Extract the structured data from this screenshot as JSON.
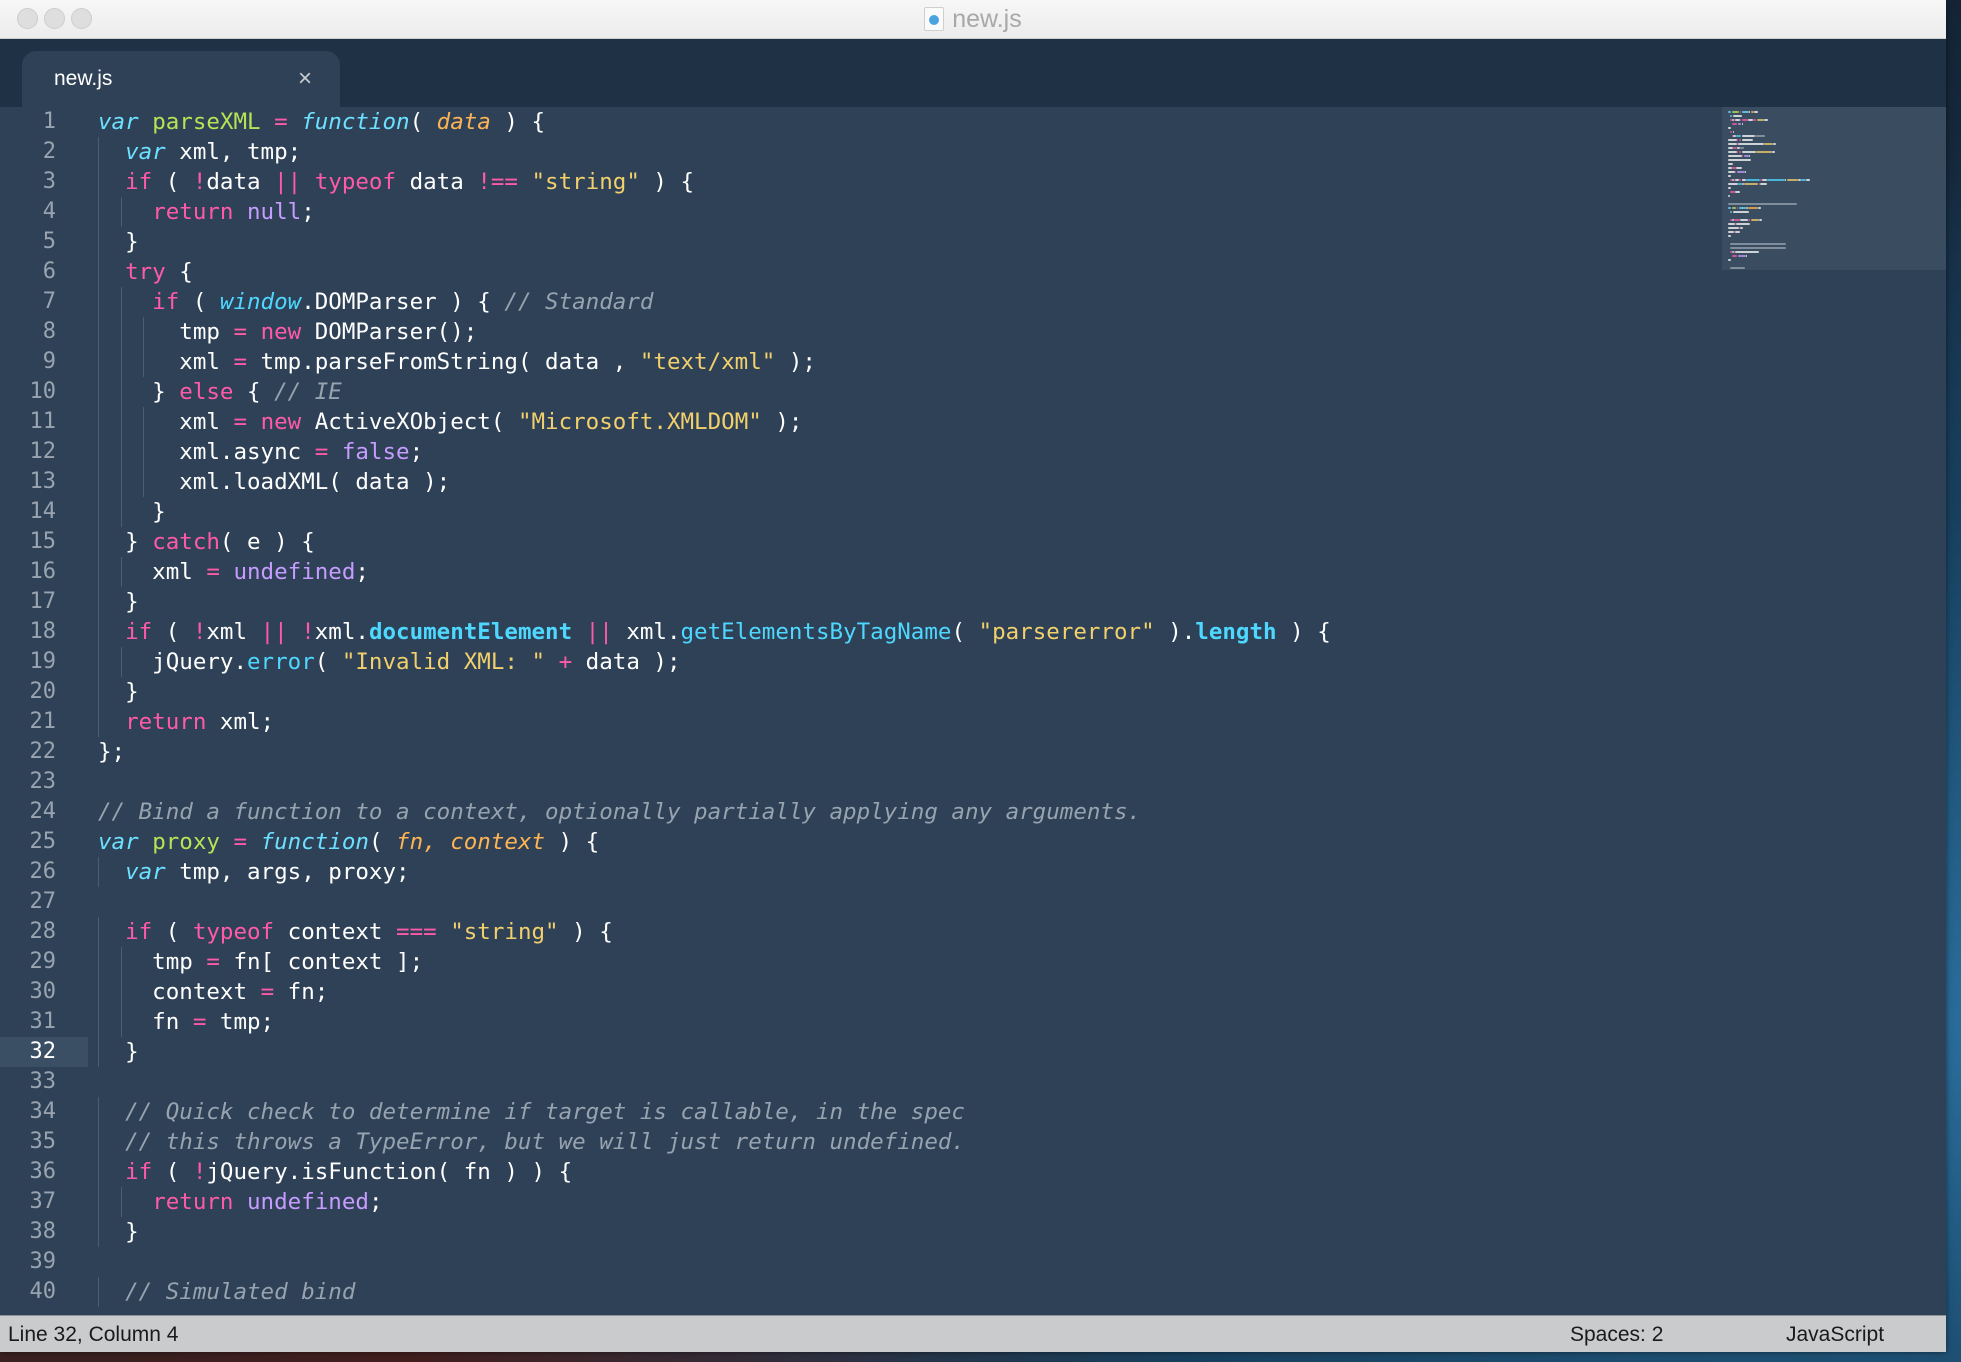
{
  "window": {
    "title": "new.js",
    "file_icon": "javascript-file-icon"
  },
  "tab": {
    "label": "new.js",
    "close_glyph": "×"
  },
  "editor": {
    "current_line": 32
  },
  "colors": {
    "background": "#2e4157",
    "plain": "#ffffff",
    "keyword": "#ff5aa8",
    "storage": "#6ee0ff",
    "function_name": "#b6e354",
    "parameter": "#ffb454",
    "string": "#f2d06b",
    "comment": "#98a3b0",
    "constant": "#c79cff",
    "support": "#4fd8ff",
    "operator": "#ff5aa8"
  },
  "code_lines": [
    [
      [
        "storage-i",
        "var"
      ],
      [
        "p",
        " "
      ],
      [
        "fn",
        "parseXML"
      ],
      [
        "p",
        " "
      ],
      [
        "op",
        "="
      ],
      [
        "p",
        " "
      ],
      [
        "storage-i",
        "function"
      ],
      [
        "p",
        "( "
      ],
      [
        "param",
        "data"
      ],
      [
        "p",
        " ) {"
      ]
    ],
    [
      [
        "p",
        "  "
      ],
      [
        "storage-i",
        "var"
      ],
      [
        "p",
        " xml, tmp;"
      ]
    ],
    [
      [
        "p",
        "  "
      ],
      [
        "kw",
        "if"
      ],
      [
        "p",
        " ( "
      ],
      [
        "op",
        "!"
      ],
      [
        "p",
        "data "
      ],
      [
        "op",
        "||"
      ],
      [
        "p",
        " "
      ],
      [
        "kw",
        "typeof"
      ],
      [
        "p",
        " data "
      ],
      [
        "op",
        "!=="
      ],
      [
        "p",
        " "
      ],
      [
        "str",
        "\"string\""
      ],
      [
        "p",
        " ) {"
      ]
    ],
    [
      [
        "p",
        "    "
      ],
      [
        "kw",
        "return"
      ],
      [
        "p",
        " "
      ],
      [
        "const",
        "null"
      ],
      [
        "p",
        ";"
      ]
    ],
    [
      [
        "p",
        "  }"
      ]
    ],
    [
      [
        "p",
        "  "
      ],
      [
        "kw",
        "try"
      ],
      [
        "p",
        " {"
      ]
    ],
    [
      [
        "p",
        "    "
      ],
      [
        "kw",
        "if"
      ],
      [
        "p",
        " ( "
      ],
      [
        "support-i",
        "window"
      ],
      [
        "p",
        ".DOMParser ) { "
      ],
      [
        "cm",
        "// Standard"
      ]
    ],
    [
      [
        "p",
        "      tmp "
      ],
      [
        "op",
        "="
      ],
      [
        "p",
        " "
      ],
      [
        "kw",
        "new"
      ],
      [
        "p",
        " DOMParser();"
      ]
    ],
    [
      [
        "p",
        "      xml "
      ],
      [
        "op",
        "="
      ],
      [
        "p",
        " tmp.parseFromString( data , "
      ],
      [
        "str",
        "\"text/xml\""
      ],
      [
        "p",
        " );"
      ]
    ],
    [
      [
        "p",
        "    } "
      ],
      [
        "kw",
        "else"
      ],
      [
        "p",
        " { "
      ],
      [
        "cm",
        "// IE"
      ]
    ],
    [
      [
        "p",
        "      xml "
      ],
      [
        "op",
        "="
      ],
      [
        "p",
        " "
      ],
      [
        "kw",
        "new"
      ],
      [
        "p",
        " ActiveXObject( "
      ],
      [
        "str",
        "\"Microsoft.XMLDOM\""
      ],
      [
        "p",
        " );"
      ]
    ],
    [
      [
        "p",
        "      xml.async "
      ],
      [
        "op",
        "="
      ],
      [
        "p",
        " "
      ],
      [
        "const",
        "false"
      ],
      [
        "p",
        ";"
      ]
    ],
    [
      [
        "p",
        "      xml.loadXML( data );"
      ]
    ],
    [
      [
        "p",
        "    }"
      ]
    ],
    [
      [
        "p",
        "  } "
      ],
      [
        "kw",
        "catch"
      ],
      [
        "p",
        "( e ) {"
      ]
    ],
    [
      [
        "p",
        "    xml "
      ],
      [
        "op",
        "="
      ],
      [
        "p",
        " "
      ],
      [
        "const",
        "undefined"
      ],
      [
        "p",
        ";"
      ]
    ],
    [
      [
        "p",
        "  }"
      ]
    ],
    [
      [
        "p",
        "  "
      ],
      [
        "kw",
        "if"
      ],
      [
        "p",
        " ( "
      ],
      [
        "op",
        "!"
      ],
      [
        "p",
        "xml "
      ],
      [
        "op",
        "||"
      ],
      [
        "p",
        " "
      ],
      [
        "op",
        "!"
      ],
      [
        "p",
        "xml."
      ],
      [
        "support-b",
        "documentElement"
      ],
      [
        "p",
        " "
      ],
      [
        "op",
        "||"
      ],
      [
        "p",
        " xml."
      ],
      [
        "support",
        "getElementsByTagName"
      ],
      [
        "p",
        "( "
      ],
      [
        "str",
        "\"parsererror\""
      ],
      [
        "p",
        " )."
      ],
      [
        "support-b",
        "length"
      ],
      [
        "p",
        " ) {"
      ]
    ],
    [
      [
        "p",
        "    jQuery."
      ],
      [
        "support",
        "error"
      ],
      [
        "p",
        "( "
      ],
      [
        "str",
        "\"Invalid XML: \""
      ],
      [
        "p",
        " "
      ],
      [
        "op",
        "+"
      ],
      [
        "p",
        " data );"
      ]
    ],
    [
      [
        "p",
        "  }"
      ]
    ],
    [
      [
        "p",
        "  "
      ],
      [
        "kw",
        "return"
      ],
      [
        "p",
        " xml;"
      ]
    ],
    [
      [
        "p",
        "};"
      ]
    ],
    [],
    [
      [
        "cm",
        "// Bind a function to a context, optionally partially applying any arguments."
      ]
    ],
    [
      [
        "storage-i",
        "var"
      ],
      [
        "p",
        " "
      ],
      [
        "fn",
        "proxy"
      ],
      [
        "p",
        " "
      ],
      [
        "op",
        "="
      ],
      [
        "p",
        " "
      ],
      [
        "storage-i",
        "function"
      ],
      [
        "p",
        "( "
      ],
      [
        "param",
        "fn, context"
      ],
      [
        "p",
        " ) {"
      ]
    ],
    [
      [
        "p",
        "  "
      ],
      [
        "storage-i",
        "var"
      ],
      [
        "p",
        " tmp, args, proxy;"
      ]
    ],
    [],
    [
      [
        "p",
        "  "
      ],
      [
        "kw",
        "if"
      ],
      [
        "p",
        " ( "
      ],
      [
        "kw",
        "typeof"
      ],
      [
        "p",
        " context "
      ],
      [
        "op",
        "==="
      ],
      [
        "p",
        " "
      ],
      [
        "str",
        "\"string\""
      ],
      [
        "p",
        " ) {"
      ]
    ],
    [
      [
        "p",
        "    tmp "
      ],
      [
        "op",
        "="
      ],
      [
        "p",
        " fn[ context ];"
      ]
    ],
    [
      [
        "p",
        "    context "
      ],
      [
        "op",
        "="
      ],
      [
        "p",
        " fn;"
      ]
    ],
    [
      [
        "p",
        "    fn "
      ],
      [
        "op",
        "="
      ],
      [
        "p",
        " tmp;"
      ]
    ],
    [
      [
        "p",
        "  }"
      ]
    ],
    [],
    [
      [
        "p",
        "  "
      ],
      [
        "cm",
        "// Quick check to determine if target is callable, in the spec"
      ]
    ],
    [
      [
        "p",
        "  "
      ],
      [
        "cm",
        "// this throws a TypeError, but we will just return undefined."
      ]
    ],
    [
      [
        "p",
        "  "
      ],
      [
        "kw",
        "if"
      ],
      [
        "p",
        " ( "
      ],
      [
        "op",
        "!"
      ],
      [
        "p",
        "jQuery.isFunction( fn ) ) {"
      ]
    ],
    [
      [
        "p",
        "    "
      ],
      [
        "kw",
        "return"
      ],
      [
        "p",
        " "
      ],
      [
        "const",
        "undefined"
      ],
      [
        "p",
        ";"
      ]
    ],
    [
      [
        "p",
        "  }"
      ]
    ],
    [],
    [
      [
        "p",
        "  "
      ],
      [
        "cm",
        "// Simulated bind"
      ]
    ]
  ],
  "status": {
    "position": "Line 32, Column 4",
    "indentation": "Spaces: 2",
    "syntax": "JavaScript"
  }
}
